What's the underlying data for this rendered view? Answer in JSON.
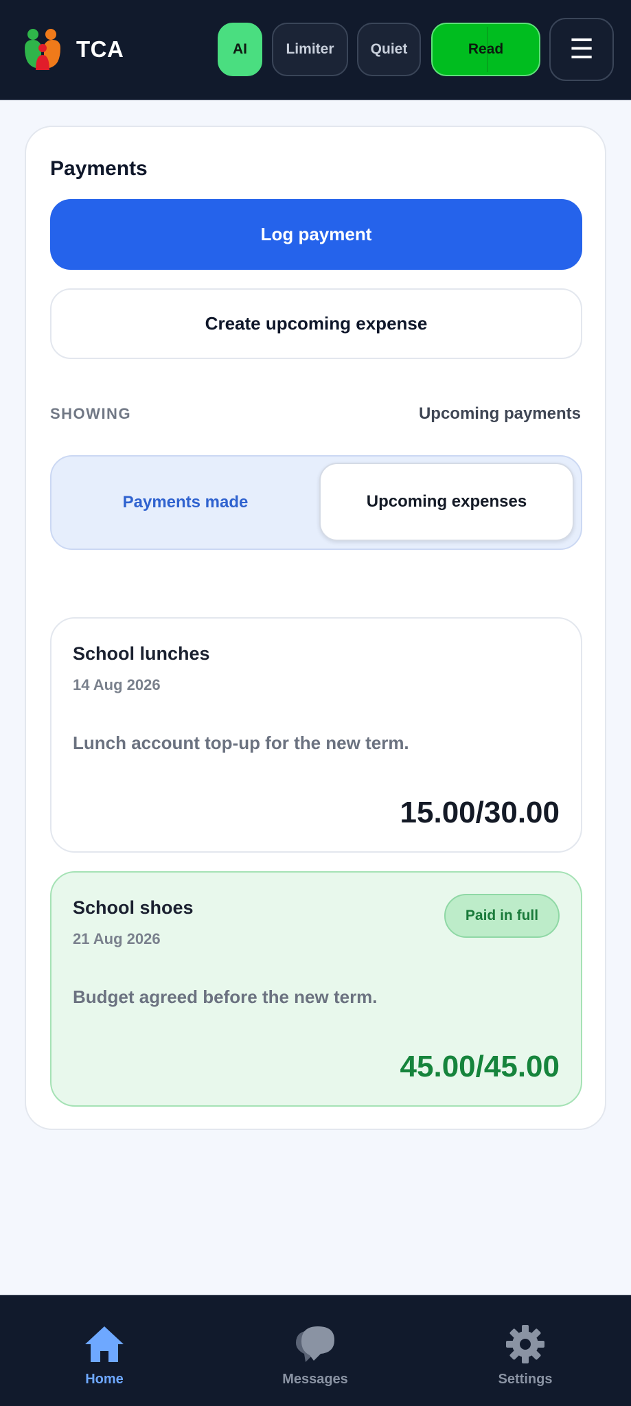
{
  "header": {
    "app_title": "TCA",
    "toggles": {
      "ai": "AI",
      "limiter": "Limiter",
      "quiet": "Quiet",
      "read": "Read"
    },
    "menu_icon": "menu-icon"
  },
  "payments": {
    "title": "Payments",
    "log_payment_label": "Log payment",
    "create_expense_label": "Create upcoming expense",
    "showing_label": "SHOWING",
    "showing_value": "Upcoming payments",
    "segments": {
      "left": "Payments made",
      "right": "Upcoming expenses"
    },
    "expenses": [
      {
        "title": "School lunches",
        "date": "14 Aug 2026",
        "description": "Lunch account top-up for the new term.",
        "amount": "15.00/30.00"
      },
      {
        "title": "School shoes",
        "date": "21 Aug 2026",
        "description": "Budget agreed before the new term.",
        "amount": "45.00/45.00",
        "badge": "Paid in full"
      }
    ]
  },
  "bottom_nav": {
    "items": [
      {
        "label": "Home",
        "icon": "home-icon",
        "active": true
      },
      {
        "label": "Messages",
        "icon": "chat-icon",
        "active": false
      },
      {
        "label": "Settings",
        "icon": "gear-icon",
        "active": false
      }
    ]
  },
  "colors": {
    "header_bg": "#111a2c",
    "page_bg": "#f4f7fd",
    "primary": "#2563eb",
    "ai_toggle": "#4ade80",
    "read_toggle": "#00bd1f",
    "paid_bg": "#e8f8ec",
    "paid_amount": "#16843c",
    "nav_active": "#6ea8ff"
  }
}
